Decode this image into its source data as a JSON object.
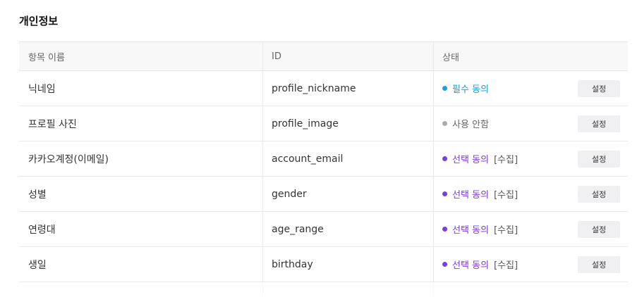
{
  "section_title": "개인정보",
  "table": {
    "headers": {
      "item_name": "항목 이름",
      "id": "ID",
      "status": "상태"
    },
    "rows": [
      {
        "name": "닉네임",
        "id": "profile_nickname",
        "status": "필수 동의",
        "status_color": "#1a9ee6",
        "dot_color": "#1a9ee6",
        "collect": "",
        "button": "설정"
      },
      {
        "name": "프로필 사진",
        "id": "profile_image",
        "status": "사용 안함",
        "status_color": "#666666",
        "dot_color": "#aaaaaa",
        "collect": "",
        "button": "설정"
      },
      {
        "name": "카카오계정(이메일)",
        "id": "account_email",
        "status": "선택 동의",
        "status_color": "#7a3de0",
        "dot_color": "#7a3de0",
        "collect": "[수집]",
        "button": "설정"
      },
      {
        "name": "성별",
        "id": "gender",
        "status": "선택 동의",
        "status_color": "#7a3de0",
        "dot_color": "#7a3de0",
        "collect": "[수집]",
        "button": "설정"
      },
      {
        "name": "연령대",
        "id": "age_range",
        "status": "선택 동의",
        "status_color": "#7a3de0",
        "dot_color": "#7a3de0",
        "collect": "[수집]",
        "button": "설정"
      },
      {
        "name": "생일",
        "id": "birthday",
        "status": "선택 동의",
        "status_color": "#7a3de0",
        "dot_color": "#7a3de0",
        "collect": "[수집]",
        "button": "설정"
      }
    ]
  }
}
